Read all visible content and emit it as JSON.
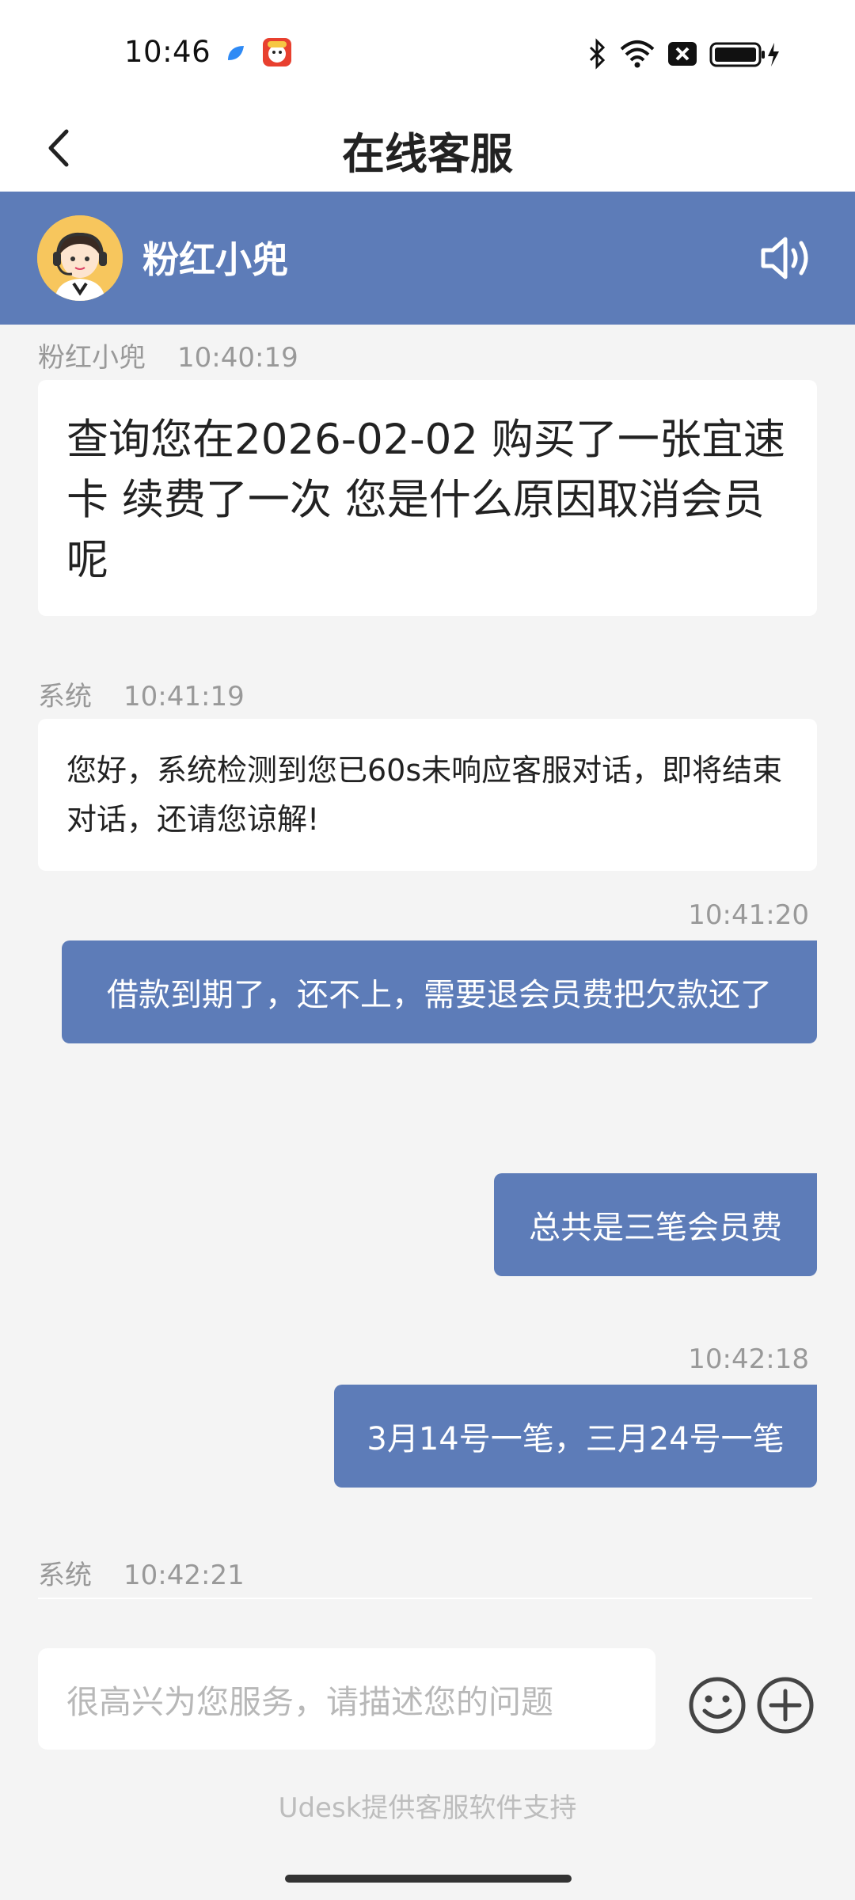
{
  "status_bar": {
    "time": "10:46"
  },
  "header": {
    "title": "在线客服",
    "back_icon": "chevron-left-icon"
  },
  "agent": {
    "name": "粉红小兜",
    "speaker_icon": "speaker-icon"
  },
  "messages": [
    {
      "side": "left",
      "sender": "粉红小兜",
      "time": "10:40:19",
      "text": "查询您在2026-02-02 购买了一张宜速卡 续费了一次 您是什么原因取消会员呢"
    },
    {
      "side": "left",
      "sender": "系统",
      "time": "10:41:19",
      "text": "您好，系统检测到您已60s未响应客服对话，即将结束对话，还请您谅解!"
    },
    {
      "side": "right",
      "time": "10:41:20",
      "text": "借款到期了，还不上，需要退会员费把欠款还了"
    },
    {
      "side": "right",
      "time": "",
      "text": "总共是三笔会员费"
    },
    {
      "side": "right",
      "time": "10:42:18",
      "text": "3月14号一笔，三月24号一笔"
    },
    {
      "side": "left",
      "sender": "系统",
      "time": "10:42:21",
      "text": ""
    }
  ],
  "input": {
    "placeholder": "很高兴为您服务，请描述您的问题",
    "emoji_icon": "smiley-icon",
    "plus_icon": "plus-circle-icon"
  },
  "footer": {
    "text": "Udesk提供客服软件支持"
  },
  "colors": {
    "brand_blue": "#5d7cb8",
    "background": "#f4f4f4"
  }
}
